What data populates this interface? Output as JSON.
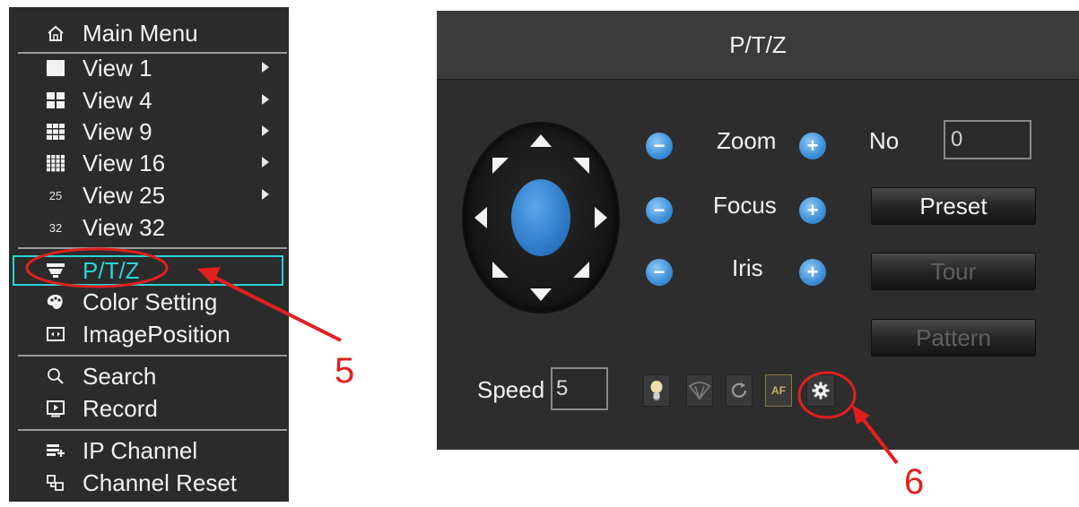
{
  "menu": {
    "items": [
      {
        "label": "Main Menu",
        "icon": "home-icon"
      },
      {
        "label": "View 1",
        "icon": "view1-icon",
        "submenu": true
      },
      {
        "label": "View 4",
        "icon": "view4-icon",
        "submenu": true
      },
      {
        "label": "View 9",
        "icon": "view9-icon",
        "submenu": true
      },
      {
        "label": "View 16",
        "icon": "view16-icon",
        "submenu": true
      },
      {
        "label": "View 25",
        "icon_text": "25",
        "submenu": true
      },
      {
        "label": "View 32",
        "icon_text": "32"
      },
      {
        "label": "P/T/Z",
        "icon": "ptz-camera-icon",
        "highlighted": true
      },
      {
        "label": "Color Setting",
        "icon": "palette-icon"
      },
      {
        "label": "ImagePosition",
        "icon": "image-position-icon"
      },
      {
        "label": "Search",
        "icon": "search-icon"
      },
      {
        "label": "Record",
        "icon": "record-icon"
      },
      {
        "label": "IP Channel",
        "icon": "ip-channel-icon"
      },
      {
        "label": "Channel Reset",
        "icon": "channel-reset-icon"
      }
    ]
  },
  "ptz": {
    "title": "P/T/Z",
    "zoom_label": "Zoom",
    "focus_label": "Focus",
    "iris_label": "Iris",
    "no_label": "No",
    "no_value": "0",
    "preset_label": "Preset",
    "tour_label": "Tour",
    "pattern_label": "Pattern",
    "speed_label": "Speed",
    "speed_value": "5",
    "tools": [
      "light-icon",
      "wiper-icon",
      "auto-scan-icon",
      "auto-focus-icon",
      "settings-gear-icon"
    ],
    "af_text": "AF"
  },
  "annotations": {
    "step5": "5",
    "step6": "6",
    "color": "#e0201c"
  },
  "colors": {
    "menu_bg": "#2b2b2b",
    "highlight": "#2ad4d8",
    "panel_bg": "#2d2d2d",
    "accent_blue": "#2f7bc8"
  }
}
